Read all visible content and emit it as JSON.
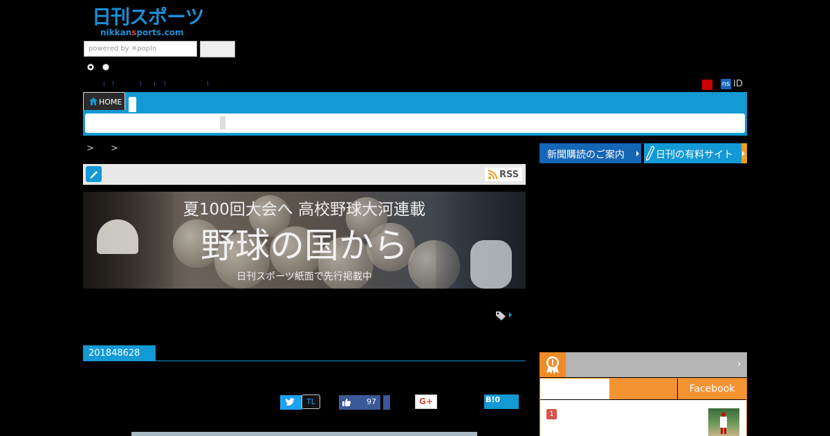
{
  "brand": {
    "logo_text": "日刊スポーツ",
    "logo_sub_a": "nikkan",
    "logo_sub_b": "s",
    "logo_sub_c": "ports.com"
  },
  "search": {
    "placeholder": "powered by ✕popIn"
  },
  "account": {
    "badge": "ns",
    "id_label": "ID"
  },
  "nav": {
    "home_label": "HOME"
  },
  "breadcrumb": {
    "text": "> >"
  },
  "section": {
    "rss_label": "RSS"
  },
  "banner": {
    "headline": "夏100回大会へ 高校野球大河連載",
    "title": "野球の国から",
    "subtitle": "日刊スポーツ紙面で先行掲載中"
  },
  "article": {
    "date": "201848628"
  },
  "share": {
    "tl_label": "TL",
    "fb_count": "97",
    "gplus_label": "G+",
    "hatena_label": "B!",
    "hatena_count": "0"
  },
  "sidebar": {
    "subscribe_label": "新聞購読のご案内",
    "paid_site_label": "日刊の有料サイト",
    "ranking_tab_fb": "Facebook",
    "ranking_first_num": "1"
  },
  "colors": {
    "accent": "#1399d4",
    "brand": "#1a8fd6",
    "ranking": "#f08c28",
    "facebook": "#3b5998",
    "twitter": "#1da1f2"
  }
}
